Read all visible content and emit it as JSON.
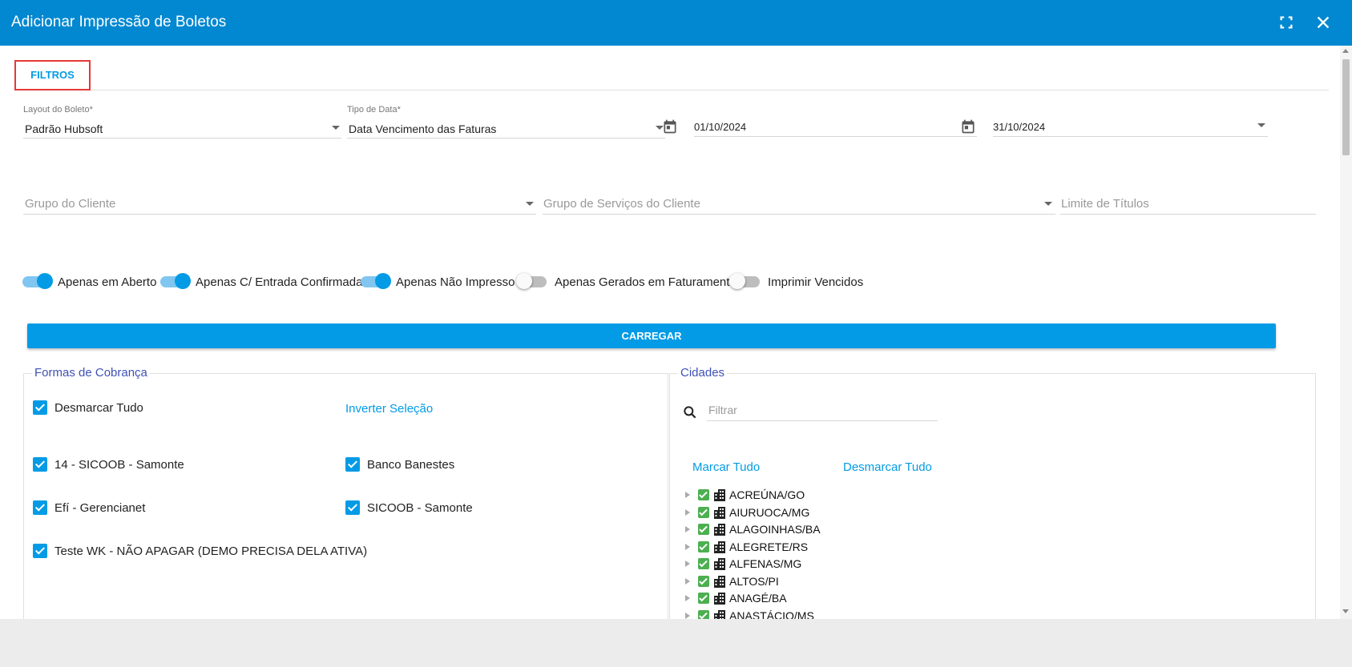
{
  "window": {
    "title": "Adicionar Impressão de Boletos"
  },
  "tabs": [
    {
      "label": "FILTROS",
      "active": true
    }
  ],
  "filters": {
    "layout": {
      "label": "Layout do Boleto",
      "required": "*",
      "value": "Padrão Hubsoft"
    },
    "date_type": {
      "label": "Tipo de Data",
      "required": "*",
      "value": "Data Vencimento das Faturas"
    },
    "date_start": "01/10/2024",
    "date_end": "31/10/2024",
    "client_group": {
      "placeholder": "Grupo do Cliente"
    },
    "service_group": {
      "placeholder": "Grupo de Serviços do Cliente"
    },
    "title_limit": {
      "placeholder": "Limite de Títulos"
    }
  },
  "toggles": [
    {
      "label": "Apenas em Aberto",
      "on": true
    },
    {
      "label": "Apenas C/ Entrada Confirmada",
      "on": true
    },
    {
      "label": "Apenas Não Impresso",
      "on": true
    },
    {
      "label": "Apenas Gerados em Faturamento",
      "on": false
    },
    {
      "label": "Imprimir Vencidos",
      "on": false
    }
  ],
  "load_button": "CARREGAR",
  "billing": {
    "title": "Formas de Cobrança",
    "unselect_all": "Desmarcar Tudo",
    "invert": "Inverter Seleção",
    "items": [
      {
        "label": "14 - SICOOB - Samonte",
        "checked": true
      },
      {
        "label": "Banco Banestes",
        "checked": true
      },
      {
        "label": "Efí - Gerencianet",
        "checked": true
      },
      {
        "label": "SICOOB - Samonte",
        "checked": true
      },
      {
        "label": "Teste WK - NÃO APAGAR (DEMO PRECISA DELA ATIVA)",
        "checked": true
      }
    ]
  },
  "cities": {
    "title": "Cidades",
    "filter_placeholder": "Filtrar",
    "select_all": "Marcar Tudo",
    "unselect_all": "Desmarcar Tudo",
    "items": [
      "ACREÚNA/GO",
      "AIURUOCA/MG",
      "ALAGOINHAS/BA",
      "ALEGRETE/RS",
      "ALFENAS/MG",
      "ALTOS/PI",
      "ANAGÉ/BA",
      "ANASTÁCIO/MS"
    ]
  },
  "colors": {
    "header": "#0288d1",
    "accent": "#039be5",
    "tab_highlight": "#e53935",
    "section_title": "#3f51b5",
    "tree_check": "#4caf50"
  },
  "icons": {
    "maximize": "fullscreen-icon",
    "close": "close-icon",
    "calendar": "calendar-icon",
    "search": "search-icon",
    "city": "building-icon"
  }
}
